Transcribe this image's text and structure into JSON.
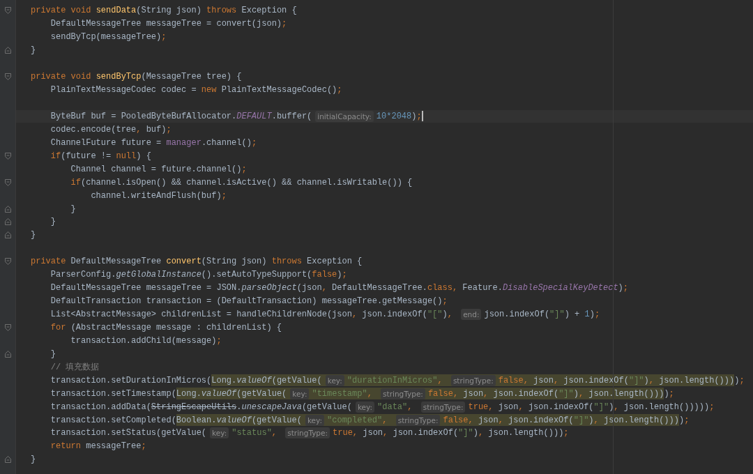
{
  "editor": {
    "lines": [
      {
        "fold_start": true,
        "current": false,
        "tokens": [
          {
            "kind": "keyword",
            "text": "private void "
          },
          {
            "kind": "method",
            "text": "sendData"
          },
          {
            "kind": "plain",
            "text": "(String json) "
          },
          {
            "kind": "keyword",
            "text": "throws "
          },
          {
            "kind": "plain",
            "text": "Exception {"
          }
        ]
      },
      {
        "current": false,
        "tokens": [
          {
            "kind": "plain",
            "text": "    DefaultMessageTree messageTree = convert(json)"
          },
          {
            "kind": "punct",
            "text": ";"
          }
        ]
      },
      {
        "current": false,
        "tokens": [
          {
            "kind": "plain",
            "text": "    sendByTcp(messageTree)"
          },
          {
            "kind": "punct",
            "text": ";"
          }
        ]
      },
      {
        "fold_end": true,
        "current": false,
        "tokens": [
          {
            "kind": "plain",
            "text": "}"
          }
        ]
      },
      {
        "current": false
      },
      {
        "fold_start": true,
        "current": false,
        "tokens": [
          {
            "kind": "keyword",
            "text": "private void "
          },
          {
            "kind": "method",
            "text": "sendByTcp"
          },
          {
            "kind": "plain",
            "text": "(MessageTree tree) {"
          }
        ]
      },
      {
        "current": false,
        "tokens": [
          {
            "kind": "plain",
            "text": "    PlainTextMessageCodec codec = "
          },
          {
            "kind": "keyword",
            "text": "new "
          },
          {
            "kind": "plain",
            "text": "PlainTextMessageCodec()"
          },
          {
            "kind": "punct",
            "text": ";"
          }
        ]
      },
      {
        "current": false
      },
      {
        "current": true,
        "tokens": [
          {
            "kind": "plain",
            "text": "    ByteBuf buf = PooledByteBufAllocator."
          },
          {
            "kind": "constant",
            "text": "DEFAULT"
          },
          {
            "kind": "plain",
            "text": ".buffer("
          },
          {
            "kind": "hint",
            "text": "initialCapacity:"
          },
          {
            "kind": "number",
            "text": "10*2048"
          },
          {
            "kind": "plain",
            "text": ")"
          },
          {
            "kind": "punct",
            "text": ";"
          }
        ]
      },
      {
        "current": false,
        "tokens": [
          {
            "kind": "plain",
            "text": "    codec.encode(tree"
          },
          {
            "kind": "punct",
            "text": ", "
          },
          {
            "kind": "plain",
            "text": "buf)"
          },
          {
            "kind": "punct",
            "text": ";"
          }
        ]
      },
      {
        "current": false,
        "tokens": [
          {
            "kind": "plain",
            "text": "    ChannelFuture future = "
          },
          {
            "kind": "field",
            "text": "manager"
          },
          {
            "kind": "plain",
            "text": ".channel()"
          },
          {
            "kind": "punct",
            "text": ";"
          }
        ]
      },
      {
        "fold_start": true,
        "current": false,
        "tokens": [
          {
            "kind": "keyword",
            "text": "    if"
          },
          {
            "kind": "plain",
            "text": "(future != "
          },
          {
            "kind": "keyword",
            "text": "null"
          },
          {
            "kind": "plain",
            "text": ") {"
          }
        ]
      },
      {
        "current": false,
        "tokens": [
          {
            "kind": "plain",
            "text": "        Channel channel = future.channel()"
          },
          {
            "kind": "punct",
            "text": ";"
          }
        ]
      },
      {
        "fold_start": true,
        "current": false,
        "tokens": [
          {
            "kind": "keyword",
            "text": "        if"
          },
          {
            "kind": "plain",
            "text": "(channel.isOpen() && channel.isActive() && channel.isWritable()) {"
          }
        ]
      },
      {
        "current": false,
        "tokens": [
          {
            "kind": "plain",
            "text": "            channel.writeAndFlush(buf)"
          },
          {
            "kind": "punct",
            "text": ";"
          }
        ]
      },
      {
        "fold_end": true,
        "current": false,
        "tokens": [
          {
            "kind": "plain",
            "text": "        }"
          }
        ]
      },
      {
        "fold_end": true,
        "current": false,
        "tokens": [
          {
            "kind": "plain",
            "text": "    }"
          }
        ]
      },
      {
        "fold_end": true,
        "current": false,
        "tokens": [
          {
            "kind": "plain",
            "text": "}"
          }
        ]
      },
      {
        "current": false
      },
      {
        "fold_start": true,
        "current": false,
        "tokens": [
          {
            "kind": "keyword",
            "text": "private "
          },
          {
            "kind": "plain",
            "text": "DefaultMessageTree "
          },
          {
            "kind": "method",
            "text": "convert"
          },
          {
            "kind": "plain",
            "text": "(String json) "
          },
          {
            "kind": "keyword",
            "text": "throws "
          },
          {
            "kind": "plain",
            "text": "Exception {"
          }
        ]
      },
      {
        "current": false,
        "tokens": [
          {
            "kind": "plain",
            "text": "    ParserConfig."
          },
          {
            "kind": "static",
            "text": "getGlobalInstance"
          },
          {
            "kind": "plain",
            "text": "().setAutoTypeSupport("
          },
          {
            "kind": "keyword",
            "text": "false"
          },
          {
            "kind": "plain",
            "text": ")"
          },
          {
            "kind": "punct",
            "text": ";"
          }
        ]
      },
      {
        "current": false,
        "tokens": [
          {
            "kind": "plain",
            "text": "    DefaultMessageTree messageTree = JSON."
          },
          {
            "kind": "static",
            "text": "parseObject"
          },
          {
            "kind": "plain",
            "text": "(json"
          },
          {
            "kind": "punct",
            "text": ", "
          },
          {
            "kind": "plain",
            "text": "DefaultMessageTree."
          },
          {
            "kind": "keyword",
            "text": "class"
          },
          {
            "kind": "punct",
            "text": ", "
          },
          {
            "kind": "plain",
            "text": "Feature."
          },
          {
            "kind": "constant",
            "text": "DisableSpecialKeyDetect"
          },
          {
            "kind": "plain",
            "text": ")"
          },
          {
            "kind": "punct",
            "text": ";"
          }
        ]
      },
      {
        "current": false,
        "tokens": [
          {
            "kind": "plain",
            "text": "    DefaultTransaction transaction = (DefaultTransaction) messageTree.getMessage()"
          },
          {
            "kind": "punct",
            "text": ";"
          }
        ]
      },
      {
        "current": false,
        "tokens": [
          {
            "kind": "plain",
            "text": "    List<AbstractMessage> childrenList = handleChildrenNode(json"
          },
          {
            "kind": "punct",
            "text": ", "
          },
          {
            "kind": "plain",
            "text": "json.indexOf("
          },
          {
            "kind": "string",
            "text": "\"[\""
          },
          {
            "kind": "plain",
            "text": ")"
          },
          {
            "kind": "punct",
            "text": ", "
          },
          {
            "kind": "hint",
            "text": "end:"
          },
          {
            "kind": "plain",
            "text": "json.indexOf("
          },
          {
            "kind": "string",
            "text": "\"]\""
          },
          {
            "kind": "plain",
            "text": ") + "
          },
          {
            "kind": "number",
            "text": "1"
          },
          {
            "kind": "plain",
            "text": ")"
          },
          {
            "kind": "punct",
            "text": ";"
          }
        ]
      },
      {
        "fold_start": true,
        "current": false,
        "tokens": [
          {
            "kind": "keyword",
            "text": "    for "
          },
          {
            "kind": "plain",
            "text": "(AbstractMessage message : childrenList) {"
          }
        ]
      },
      {
        "current": false,
        "tokens": [
          {
            "kind": "plain",
            "text": "        transaction.addChild(message)"
          },
          {
            "kind": "punct",
            "text": ";"
          }
        ]
      },
      {
        "fold_end": true,
        "current": false,
        "tokens": [
          {
            "kind": "plain",
            "text": "    }"
          }
        ]
      },
      {
        "current": false,
        "tokens": [
          {
            "kind": "comment",
            "text": "    // 填充数据"
          }
        ]
      },
      {
        "current": false,
        "tokens": [
          {
            "kind": "plain",
            "text": "    transaction.setDurationInMicros("
          },
          {
            "kind": "highlight",
            "children": [
              {
                "kind": "plain",
                "text": "Long."
              },
              {
                "kind": "static",
                "text": "valueOf"
              },
              {
                "kind": "plain",
                "text": "(getValue("
              },
              {
                "kind": "hint",
                "text": "key:"
              },
              {
                "kind": "string",
                "text": "\"durationInMicros\""
              },
              {
                "kind": "punct",
                "text": ", "
              },
              {
                "kind": "hint",
                "text": "stringType:"
              },
              {
                "kind": "keyword",
                "text": "false"
              },
              {
                "kind": "punct",
                "text": ", "
              },
              {
                "kind": "plain",
                "text": "json"
              },
              {
                "kind": "punct",
                "text": ", "
              },
              {
                "kind": "plain",
                "text": "json.indexOf("
              },
              {
                "kind": "string",
                "text": "\"]\""
              },
              {
                "kind": "plain",
                "text": ")"
              },
              {
                "kind": "punct",
                "text": ", "
              },
              {
                "kind": "plain",
                "text": "json.length()))"
              }
            ]
          },
          {
            "kind": "plain",
            "text": ")"
          },
          {
            "kind": "punct",
            "text": ";"
          }
        ]
      },
      {
        "current": false,
        "tokens": [
          {
            "kind": "plain",
            "text": "    transaction.setTimestamp("
          },
          {
            "kind": "highlight",
            "children": [
              {
                "kind": "plain",
                "text": "Long."
              },
              {
                "kind": "static",
                "text": "valueOf"
              },
              {
                "kind": "plain",
                "text": "(getValue("
              },
              {
                "kind": "hint",
                "text": "key:"
              },
              {
                "kind": "string",
                "text": "\"timestamp\""
              },
              {
                "kind": "punct",
                "text": ", "
              },
              {
                "kind": "hint",
                "text": "stringType:"
              },
              {
                "kind": "keyword",
                "text": "false"
              },
              {
                "kind": "punct",
                "text": ", "
              },
              {
                "kind": "plain",
                "text": "json"
              },
              {
                "kind": "punct",
                "text": ", "
              },
              {
                "kind": "plain",
                "text": "json.indexOf("
              },
              {
                "kind": "string",
                "text": "\"]\""
              },
              {
                "kind": "plain",
                "text": ")"
              },
              {
                "kind": "punct",
                "text": ", "
              },
              {
                "kind": "plain",
                "text": "json.length()))"
              }
            ]
          },
          {
            "kind": "plain",
            "text": ")"
          },
          {
            "kind": "punct",
            "text": ";"
          }
        ]
      },
      {
        "current": false,
        "tokens": [
          {
            "kind": "plain",
            "text": "    transaction.addData("
          },
          {
            "kind": "deprecated",
            "text": "StringEscapeUtils"
          },
          {
            "kind": "plain",
            "text": "."
          },
          {
            "kind": "static",
            "text": "unescapeJava"
          },
          {
            "kind": "plain",
            "text": "(getValue("
          },
          {
            "kind": "hint",
            "text": "key:"
          },
          {
            "kind": "string",
            "text": "\"data\""
          },
          {
            "kind": "punct",
            "text": ", "
          },
          {
            "kind": "hint",
            "text": "stringType:"
          },
          {
            "kind": "keyword",
            "text": "true"
          },
          {
            "kind": "punct",
            "text": ", "
          },
          {
            "kind": "plain",
            "text": "json"
          },
          {
            "kind": "punct",
            "text": ", "
          },
          {
            "kind": "plain",
            "text": "json.indexOf("
          },
          {
            "kind": "string",
            "text": "\"]\""
          },
          {
            "kind": "plain",
            "text": ")"
          },
          {
            "kind": "punct",
            "text": ", "
          },
          {
            "kind": "plain",
            "text": "json.length()))))"
          },
          {
            "kind": "punct",
            "text": ";"
          }
        ]
      },
      {
        "current": false,
        "tokens": [
          {
            "kind": "plain",
            "text": "    transaction.setCompleted("
          },
          {
            "kind": "highlight",
            "children": [
              {
                "kind": "plain",
                "text": "Boolean."
              },
              {
                "kind": "static",
                "text": "valueOf"
              },
              {
                "kind": "plain",
                "text": "(getValue("
              },
              {
                "kind": "hint",
                "text": "key:"
              },
              {
                "kind": "string",
                "text": "\"completed\""
              },
              {
                "kind": "punct",
                "text": ", "
              },
              {
                "kind": "hint",
                "text": "stringType:"
              },
              {
                "kind": "keyword",
                "text": "false"
              },
              {
                "kind": "punct",
                "text": ", "
              },
              {
                "kind": "plain",
                "text": "json"
              },
              {
                "kind": "punct",
                "text": ", "
              },
              {
                "kind": "plain",
                "text": "json.indexOf("
              },
              {
                "kind": "string",
                "text": "\"]\""
              },
              {
                "kind": "plain",
                "text": ")"
              },
              {
                "kind": "punct",
                "text": ", "
              },
              {
                "kind": "plain",
                "text": "json.length()))"
              }
            ]
          },
          {
            "kind": "plain",
            "text": ")"
          },
          {
            "kind": "punct",
            "text": ";"
          }
        ]
      },
      {
        "current": false,
        "tokens": [
          {
            "kind": "plain",
            "text": "    transaction.setStatus(getValue("
          },
          {
            "kind": "hint",
            "text": "key:"
          },
          {
            "kind": "string",
            "text": "\"status\""
          },
          {
            "kind": "punct",
            "text": ", "
          },
          {
            "kind": "hint",
            "text": "stringType:"
          },
          {
            "kind": "keyword",
            "text": "true"
          },
          {
            "kind": "punct",
            "text": ", "
          },
          {
            "kind": "plain",
            "text": "json"
          },
          {
            "kind": "punct",
            "text": ", "
          },
          {
            "kind": "plain",
            "text": "json.indexOf("
          },
          {
            "kind": "string",
            "text": "\"]\""
          },
          {
            "kind": "plain",
            "text": ")"
          },
          {
            "kind": "punct",
            "text": ", "
          },
          {
            "kind": "plain",
            "text": "json.length()))"
          },
          {
            "kind": "punct",
            "text": ";"
          }
        ]
      },
      {
        "current": false,
        "tokens": [
          {
            "kind": "keyword",
            "text": "    return "
          },
          {
            "kind": "plain",
            "text": "messageTree"
          },
          {
            "kind": "punct",
            "text": ";"
          }
        ]
      },
      {
        "fold_end": true,
        "current": false,
        "tokens": [
          {
            "kind": "plain",
            "text": "}"
          }
        ]
      }
    ]
  }
}
